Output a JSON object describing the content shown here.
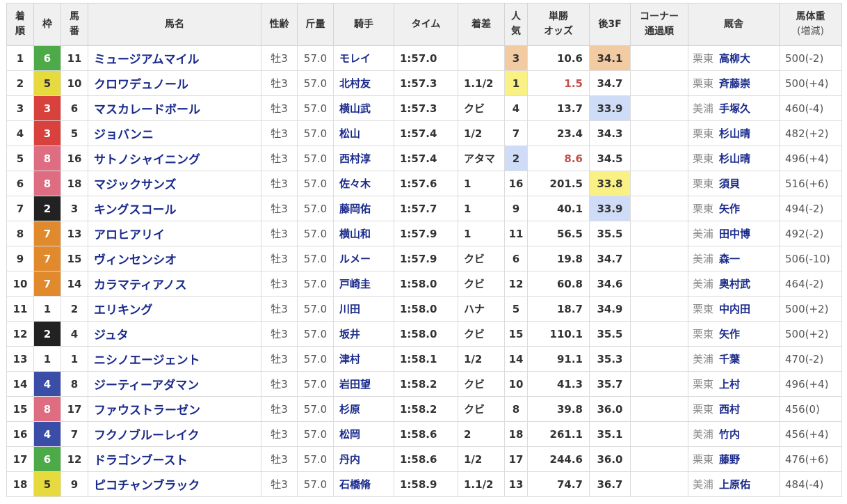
{
  "headers": {
    "finish": [
      "着",
      "順"
    ],
    "waku": "枠",
    "number": [
      "馬",
      "番"
    ],
    "horse": "馬名",
    "sex_age": "性齢",
    "weight": "斤量",
    "jockey": "騎手",
    "time": "タイム",
    "margin": "着差",
    "popularity": [
      "人",
      "気"
    ],
    "odds": [
      "単勝",
      "オッズ"
    ],
    "last3f": "後3F",
    "corner": [
      "コーナー",
      "通過順"
    ],
    "stable": "厩舎",
    "body_weight": [
      "馬体重",
      "(増減)"
    ]
  },
  "colors": {
    "waku_1": "#ffffff",
    "waku_2": "#222222",
    "waku_3": "#d8413c",
    "waku_4": "#3a4ea8",
    "waku_5": "#e6da3e",
    "waku_6": "#4caa48",
    "waku_7": "#e08a2d",
    "waku_8": "#df6d82",
    "highlight_1st": "#f2cba3",
    "highlight_2nd": "#cfdcf8",
    "highlight_3rd": "#faf184",
    "odds_favorite": "#c0504d",
    "link_text": "#1a2a8c"
  },
  "rows": [
    {
      "pos": "1",
      "waku": "6",
      "num": "11",
      "horse": "ミュージアムマイル",
      "sex_age": "牡3",
      "weight": "57.0",
      "jockey": "モレイ",
      "time": "1:57.0",
      "margin": "",
      "pop": "3",
      "odds": "10.6",
      "last3f": "34.1",
      "corner": "",
      "region": "栗東",
      "trainer": "高柳大",
      "body_weight": "500(-2)"
    },
    {
      "pos": "2",
      "waku": "5",
      "num": "10",
      "horse": "クロワデュノール",
      "sex_age": "牡3",
      "weight": "57.0",
      "jockey": "北村友",
      "time": "1:57.3",
      "margin": "1.1/2",
      "pop": "1",
      "odds": "1.5",
      "last3f": "34.7",
      "corner": "",
      "region": "栗東",
      "trainer": "斉藤崇",
      "body_weight": "500(+4)"
    },
    {
      "pos": "3",
      "waku": "3",
      "num": "6",
      "horse": "マスカレードボール",
      "sex_age": "牡3",
      "weight": "57.0",
      "jockey": "横山武",
      "time": "1:57.3",
      "margin": "クビ",
      "pop": "4",
      "odds": "13.7",
      "last3f": "33.9",
      "corner": "",
      "region": "美浦",
      "trainer": "手塚久",
      "body_weight": "460(-4)"
    },
    {
      "pos": "4",
      "waku": "3",
      "num": "5",
      "horse": "ジョバンニ",
      "sex_age": "牡3",
      "weight": "57.0",
      "jockey": "松山",
      "time": "1:57.4",
      "margin": "1/2",
      "pop": "7",
      "odds": "23.4",
      "last3f": "34.3",
      "corner": "",
      "region": "栗東",
      "trainer": "杉山晴",
      "body_weight": "482(+2)"
    },
    {
      "pos": "5",
      "waku": "8",
      "num": "16",
      "horse": "サトノシャイニング",
      "sex_age": "牡3",
      "weight": "57.0",
      "jockey": "西村淳",
      "time": "1:57.4",
      "margin": "アタマ",
      "pop": "2",
      "odds": "8.6",
      "last3f": "34.5",
      "corner": "",
      "region": "栗東",
      "trainer": "杉山晴",
      "body_weight": "496(+4)"
    },
    {
      "pos": "6",
      "waku": "8",
      "num": "18",
      "horse": "マジックサンズ",
      "sex_age": "牡3",
      "weight": "57.0",
      "jockey": "佐々木",
      "time": "1:57.6",
      "margin": "1",
      "pop": "16",
      "odds": "201.5",
      "last3f": "33.8",
      "corner": "",
      "region": "栗東",
      "trainer": "須貝",
      "body_weight": "516(+6)"
    },
    {
      "pos": "7",
      "waku": "2",
      "num": "3",
      "horse": "キングスコール",
      "sex_age": "牡3",
      "weight": "57.0",
      "jockey": "藤岡佑",
      "time": "1:57.7",
      "margin": "1",
      "pop": "9",
      "odds": "40.1",
      "last3f": "33.9",
      "corner": "",
      "region": "栗東",
      "trainer": "矢作",
      "body_weight": "494(-2)"
    },
    {
      "pos": "8",
      "waku": "7",
      "num": "13",
      "horse": "アロヒアリイ",
      "sex_age": "牡3",
      "weight": "57.0",
      "jockey": "横山和",
      "time": "1:57.9",
      "margin": "1",
      "pop": "11",
      "odds": "56.5",
      "last3f": "35.5",
      "corner": "",
      "region": "美浦",
      "trainer": "田中博",
      "body_weight": "492(-2)"
    },
    {
      "pos": "9",
      "waku": "7",
      "num": "15",
      "horse": "ヴィンセンシオ",
      "sex_age": "牡3",
      "weight": "57.0",
      "jockey": "ルメー",
      "time": "1:57.9",
      "margin": "クビ",
      "pop": "6",
      "odds": "19.8",
      "last3f": "34.7",
      "corner": "",
      "region": "美浦",
      "trainer": "森一",
      "body_weight": "506(-10)"
    },
    {
      "pos": "10",
      "waku": "7",
      "num": "14",
      "horse": "カラマティアノス",
      "sex_age": "牡3",
      "weight": "57.0",
      "jockey": "戸崎圭",
      "time": "1:58.0",
      "margin": "クビ",
      "pop": "12",
      "odds": "60.8",
      "last3f": "34.6",
      "corner": "",
      "region": "美浦",
      "trainer": "奥村武",
      "body_weight": "464(-2)"
    },
    {
      "pos": "11",
      "waku": "1",
      "num": "2",
      "horse": "エリキング",
      "sex_age": "牡3",
      "weight": "57.0",
      "jockey": "川田",
      "time": "1:58.0",
      "margin": "ハナ",
      "pop": "5",
      "odds": "18.7",
      "last3f": "34.9",
      "corner": "",
      "region": "栗東",
      "trainer": "中内田",
      "body_weight": "500(+2)"
    },
    {
      "pos": "12",
      "waku": "2",
      "num": "4",
      "horse": "ジュタ",
      "sex_age": "牡3",
      "weight": "57.0",
      "jockey": "坂井",
      "time": "1:58.0",
      "margin": "クビ",
      "pop": "15",
      "odds": "110.1",
      "last3f": "35.5",
      "corner": "",
      "region": "栗東",
      "trainer": "矢作",
      "body_weight": "500(+2)"
    },
    {
      "pos": "13",
      "waku": "1",
      "num": "1",
      "horse": "ニシノエージェント",
      "sex_age": "牡3",
      "weight": "57.0",
      "jockey": "津村",
      "time": "1:58.1",
      "margin": "1/2",
      "pop": "14",
      "odds": "91.1",
      "last3f": "35.3",
      "corner": "",
      "region": "美浦",
      "trainer": "千葉",
      "body_weight": "470(-2)"
    },
    {
      "pos": "14",
      "waku": "4",
      "num": "8",
      "horse": "ジーティーアダマン",
      "sex_age": "牡3",
      "weight": "57.0",
      "jockey": "岩田望",
      "time": "1:58.2",
      "margin": "クビ",
      "pop": "10",
      "odds": "41.3",
      "last3f": "35.7",
      "corner": "",
      "region": "栗東",
      "trainer": "上村",
      "body_weight": "496(+4)"
    },
    {
      "pos": "15",
      "waku": "8",
      "num": "17",
      "horse": "ファウストラーゼン",
      "sex_age": "牡3",
      "weight": "57.0",
      "jockey": "杉原",
      "time": "1:58.2",
      "margin": "クビ",
      "pop": "8",
      "odds": "39.8",
      "last3f": "36.0",
      "corner": "",
      "region": "栗東",
      "trainer": "西村",
      "body_weight": "456(0)"
    },
    {
      "pos": "16",
      "waku": "4",
      "num": "7",
      "horse": "フクノブルーレイク",
      "sex_age": "牡3",
      "weight": "57.0",
      "jockey": "松岡",
      "time": "1:58.6",
      "margin": "2",
      "pop": "18",
      "odds": "261.1",
      "last3f": "35.1",
      "corner": "",
      "region": "美浦",
      "trainer": "竹内",
      "body_weight": "456(+4)"
    },
    {
      "pos": "17",
      "waku": "6",
      "num": "12",
      "horse": "ドラゴンブースト",
      "sex_age": "牡3",
      "weight": "57.0",
      "jockey": "丹内",
      "time": "1:58.6",
      "margin": "1/2",
      "pop": "17",
      "odds": "244.6",
      "last3f": "36.0",
      "corner": "",
      "region": "栗東",
      "trainer": "藤野",
      "body_weight": "476(+6)"
    },
    {
      "pos": "18",
      "waku": "5",
      "num": "9",
      "horse": "ピコチャンブラック",
      "sex_age": "牡3",
      "weight": "57.0",
      "jockey": "石橋脩",
      "time": "1:58.9",
      "margin": "1.1/2",
      "pop": "13",
      "odds": "74.7",
      "last3f": "36.7",
      "corner": "",
      "region": "美浦",
      "trainer": "上原佑",
      "body_weight": "484(-4)"
    }
  ]
}
